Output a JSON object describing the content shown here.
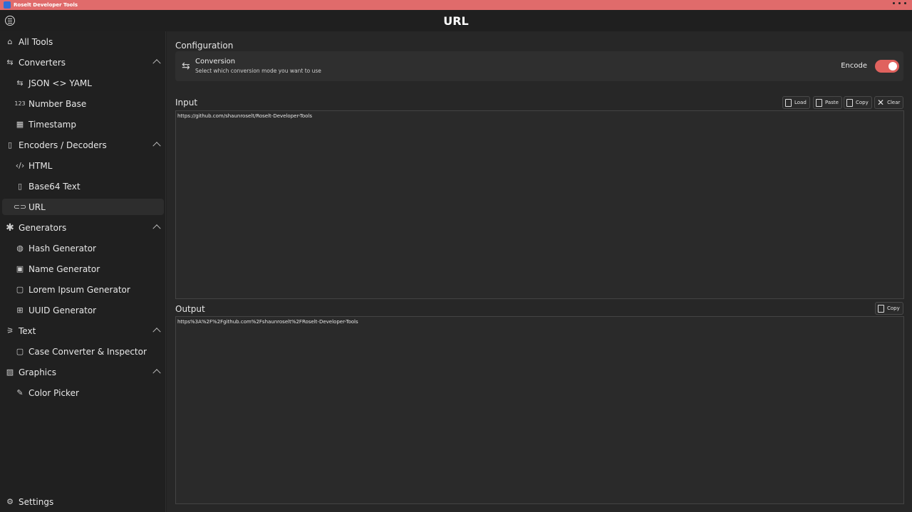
{
  "window": {
    "title": "Roselt Developer Tools"
  },
  "header": {
    "title": "URL"
  },
  "sidebar": {
    "all_tools": "All Tools",
    "converters": {
      "label": "Converters",
      "items": [
        "JSON <> YAML",
        "Number Base",
        "Timestamp"
      ]
    },
    "encoders": {
      "label": "Encoders / Decoders",
      "items": [
        "HTML",
        "Base64 Text",
        "URL"
      ]
    },
    "generators": {
      "label": "Generators",
      "items": [
        "Hash Generator",
        "Name Generator",
        "Lorem Ipsum Generator",
        "UUID Generator"
      ]
    },
    "text": {
      "label": "Text",
      "items": [
        "Case Converter & Inspector"
      ]
    },
    "graphics": {
      "label": "Graphics",
      "items": [
        "Color Picker"
      ]
    },
    "settings": "Settings",
    "number_icon": "123"
  },
  "config": {
    "section_label": "Configuration",
    "conversion_title": "Conversion",
    "conversion_desc": "Select which conversion mode you want to use",
    "mode_label": "Encode",
    "mode_on": true
  },
  "input": {
    "label": "Input",
    "value": "https://github.com/shaunroselt/Roselt-Developer-Tools",
    "buttons": {
      "load": "Load",
      "paste": "Paste",
      "copy": "Copy",
      "clear": "Clear"
    }
  },
  "output": {
    "label": "Output",
    "value": "https%3A%2F%2Fgithub.com%2Fshaunroselt%2FRoselt-Developer-Tools",
    "copy": "Copy"
  },
  "colors": {
    "accent": "#e0625e",
    "titlebar": "#e06b6b"
  }
}
